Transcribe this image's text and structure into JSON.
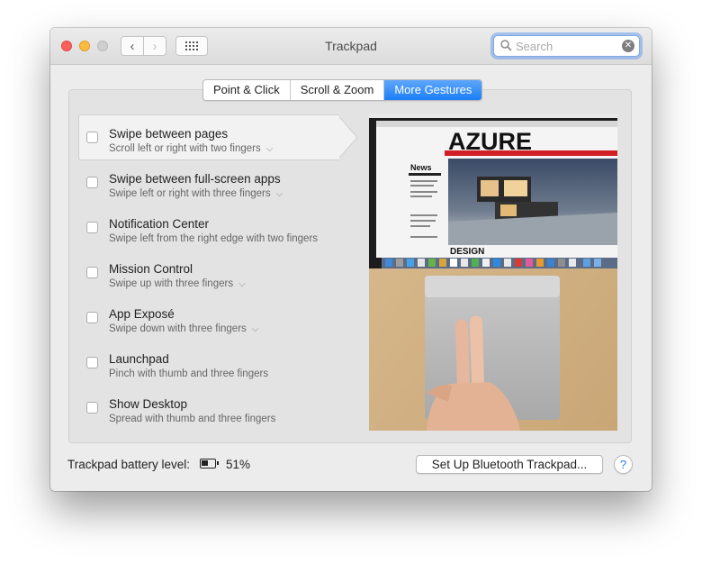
{
  "window": {
    "title": "Trackpad"
  },
  "toolbar": {
    "back_glyph": "‹",
    "forward_glyph": "›",
    "grid_icon": "grid-icon"
  },
  "search": {
    "placeholder": "Search"
  },
  "tabs": [
    {
      "label": "Point & Click",
      "active": false
    },
    {
      "label": "Scroll & Zoom",
      "active": false
    },
    {
      "label": "More Gestures",
      "active": true
    }
  ],
  "gestures": [
    {
      "name": "Swipe between pages",
      "description": "Scroll left or right with two fingers",
      "checked": false,
      "has_menu": true
    },
    {
      "name": "Swipe between full-screen apps",
      "description": "Swipe left or right with three fingers",
      "checked": false,
      "has_menu": true
    },
    {
      "name": "Notification Center",
      "description": "Swipe left from the right edge with two fingers",
      "checked": false,
      "has_menu": false
    },
    {
      "name": "Mission Control",
      "description": "Swipe up with three fingers",
      "checked": false,
      "has_menu": true
    },
    {
      "name": "App Exposé",
      "description": "Swipe down with three fingers",
      "checked": false,
      "has_menu": true
    },
    {
      "name": "Launchpad",
      "description": "Pinch with thumb and three fingers",
      "checked": false,
      "has_menu": false
    },
    {
      "name": "Show Desktop",
      "description": "Spread with thumb and three fingers",
      "checked": false,
      "has_menu": false
    }
  ],
  "preview": {
    "magazine_title": "AZURE",
    "news_heading": "News",
    "design_heading": "DESIGN"
  },
  "footer": {
    "battery_label": "Trackpad battery level:",
    "battery_percent": "51%",
    "battery_level": 0.51,
    "setup_button": "Set Up Bluetooth Trackpad...",
    "help_glyph": "?"
  },
  "colors": {
    "accent": "#1a7ef6",
    "close": "#fc605c",
    "minimize": "#fdbc40",
    "zoom_disabled": "#cfcfcf"
  }
}
